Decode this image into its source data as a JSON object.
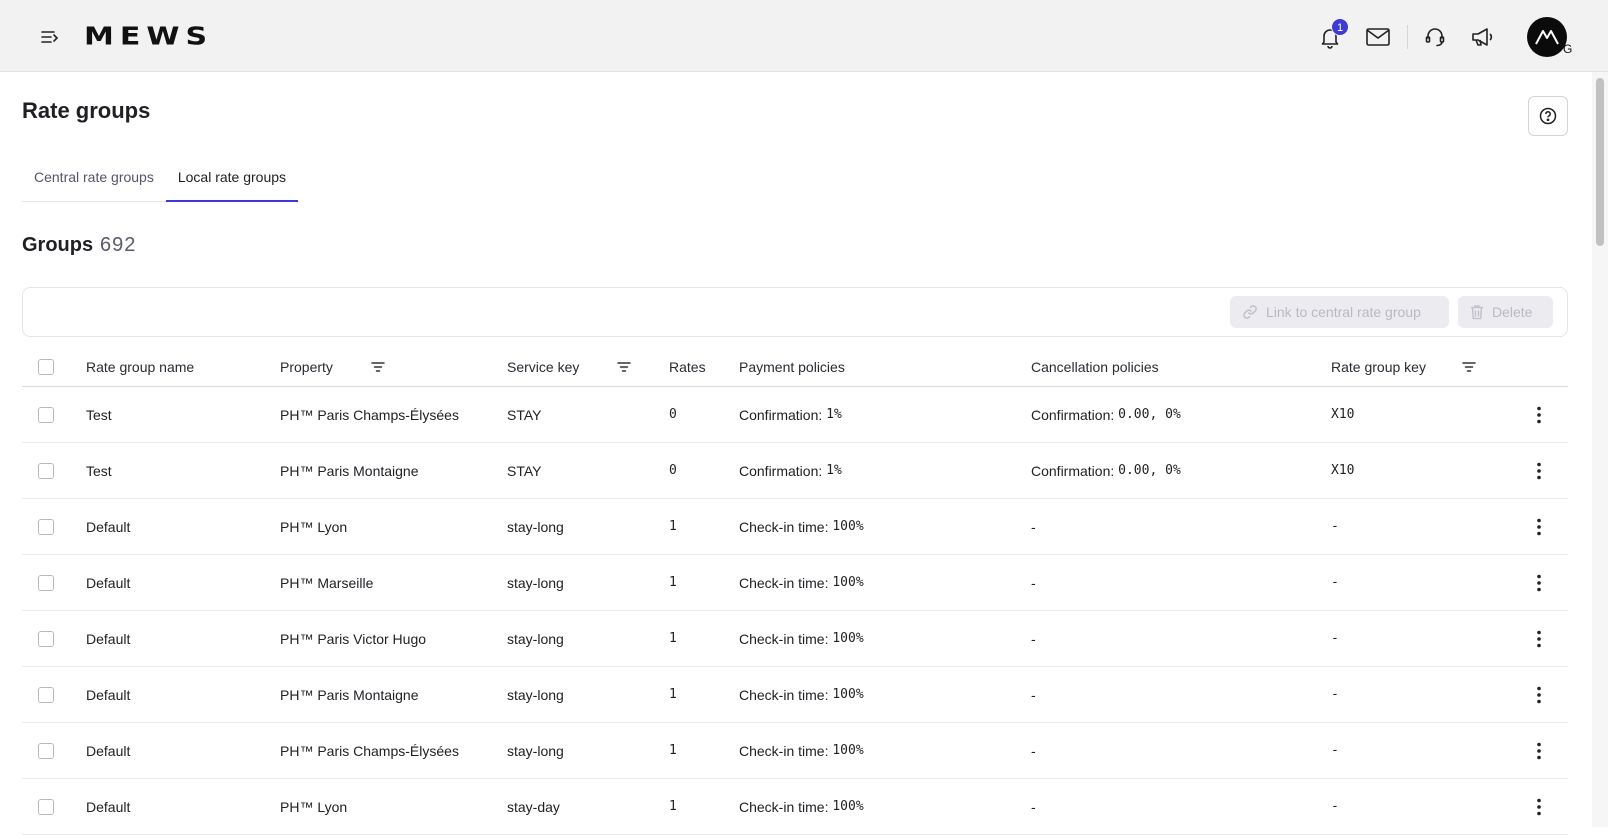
{
  "app": {
    "logo": "MEWS",
    "notification_count": "1",
    "avatar_initial": "G",
    "icons": [
      "menu-icon",
      "bell-icon",
      "mail-icon",
      "support-icon",
      "announcement-icon",
      "user-avatar"
    ]
  },
  "page": {
    "title": "Rate groups",
    "help_icon": "help-icon"
  },
  "tabs": [
    {
      "label": "Central rate groups",
      "active": false
    },
    {
      "label": "Local rate groups",
      "active": true
    }
  ],
  "groups": {
    "title": "Groups",
    "count": "692"
  },
  "actions": {
    "link_label": "Link to central rate group",
    "delete_label": "Delete"
  },
  "table": {
    "columns": {
      "name": "Rate group name",
      "property": "Property",
      "service_key": "Service key",
      "rates": "Rates",
      "payment": "Payment policies",
      "cancellation": "Cancellation policies",
      "key": "Rate group key"
    },
    "rows": [
      {
        "name": "Test",
        "property": "PH™ Paris Champs-Élysées",
        "service_key": "STAY",
        "rates": "0",
        "payment_label": "Confirmation:",
        "payment_value": "1%",
        "cancel_label": "Confirmation:",
        "cancel_value": "0.00, 0%",
        "key": "X10"
      },
      {
        "name": "Test",
        "property": "PH™ Paris Montaigne",
        "service_key": "STAY",
        "rates": "0",
        "payment_label": "Confirmation:",
        "payment_value": "1%",
        "cancel_label": "Confirmation:",
        "cancel_value": "0.00, 0%",
        "key": "X10"
      },
      {
        "name": "Default",
        "property": "PH™ Lyon",
        "service_key": "stay-long",
        "rates": "1",
        "payment_label": "Check-in time:",
        "payment_value": "100%",
        "cancel_label": "-",
        "cancel_value": "",
        "key": "-"
      },
      {
        "name": "Default",
        "property": "PH™ Marseille",
        "service_key": "stay-long",
        "rates": "1",
        "payment_label": "Check-in time:",
        "payment_value": "100%",
        "cancel_label": "-",
        "cancel_value": "",
        "key": "-"
      },
      {
        "name": "Default",
        "property": "PH™ Paris Victor Hugo",
        "service_key": "stay-long",
        "rates": "1",
        "payment_label": "Check-in time:",
        "payment_value": "100%",
        "cancel_label": "-",
        "cancel_value": "",
        "key": "-"
      },
      {
        "name": "Default",
        "property": "PH™ Paris Montaigne",
        "service_key": "stay-long",
        "rates": "1",
        "payment_label": "Check-in time:",
        "payment_value": "100%",
        "cancel_label": "-",
        "cancel_value": "",
        "key": "-"
      },
      {
        "name": "Default",
        "property": "PH™ Paris Champs-Élysées",
        "service_key": "stay-long",
        "rates": "1",
        "payment_label": "Check-in time:",
        "payment_value": "100%",
        "cancel_label": "-",
        "cancel_value": "",
        "key": "-"
      },
      {
        "name": "Default",
        "property": "PH™ Lyon",
        "service_key": "stay-day",
        "rates": "1",
        "payment_label": "Check-in time:",
        "payment_value": "100%",
        "cancel_label": "-",
        "cancel_value": "",
        "key": "-"
      }
    ]
  },
  "colors": {
    "accent": "#3d3bd1",
    "topbar_bg": "#f2f2f2"
  }
}
